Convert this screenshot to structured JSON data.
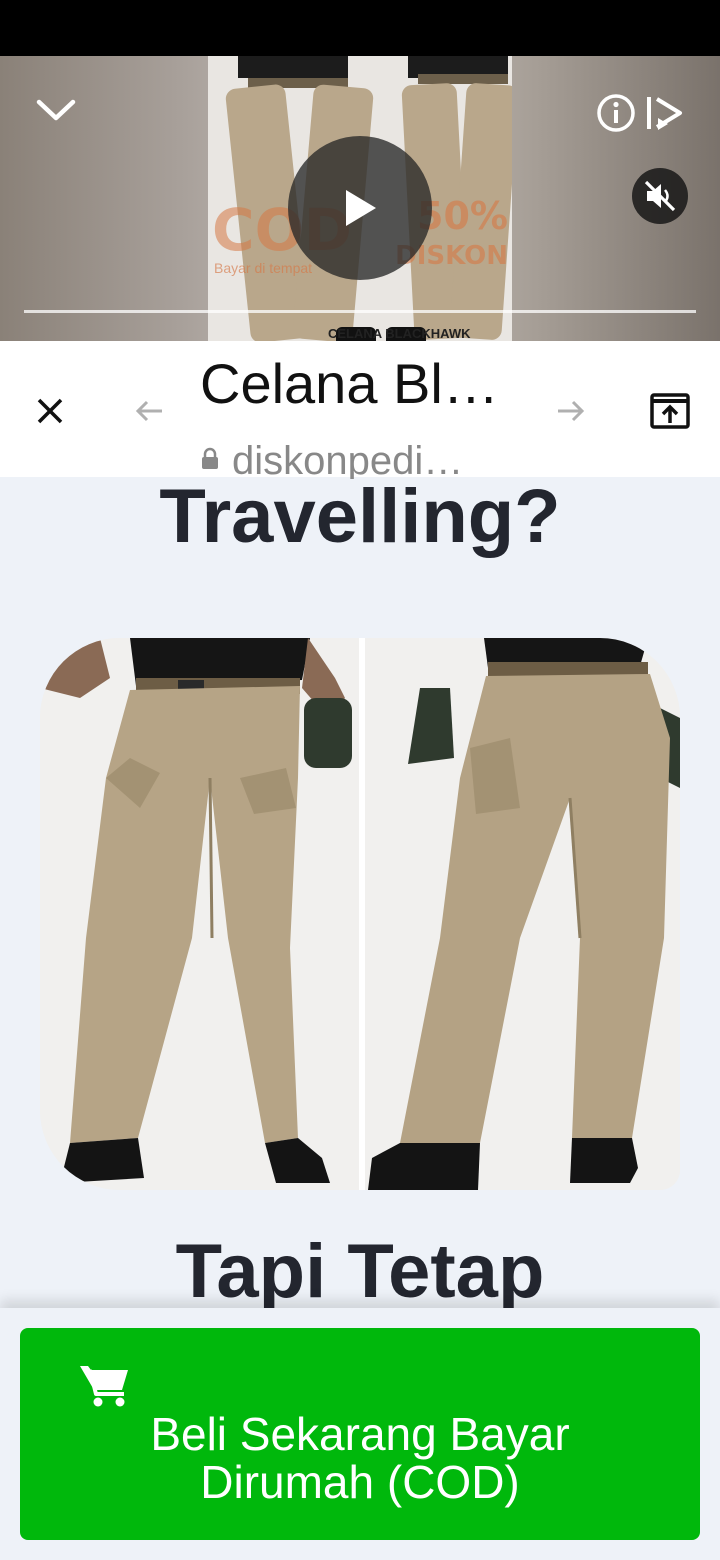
{
  "video": {
    "thumbnail": {
      "cod_text": "COD",
      "cod_sub": "Bayar di tempat",
      "discount_percent": "50%",
      "discount_label": "DISKON",
      "caption": "CELANA BLACKHAWK"
    },
    "icons": {
      "collapse": "chevron-down-icon",
      "play": "play-icon",
      "info": "info-icon",
      "play_next": "play-next-icon",
      "mute": "volume-muted-icon"
    }
  },
  "browser": {
    "title": "Celana Bl…",
    "url": "diskonpedi…",
    "icons": {
      "close": "close-icon",
      "back": "arrow-left-icon",
      "forward": "arrow-right-icon",
      "open_in_browser": "open-in-browser-icon",
      "lock": "lock-icon"
    }
  },
  "page": {
    "heading_1": "Travelling?",
    "heading_2": "Tapi Tetap",
    "product_image": "khaki tactical cargo pants worn by model, front and back views"
  },
  "cta": {
    "label": "Beli Sekarang Bayar Dirumah (COD)",
    "icon": "shopping-cart-icon",
    "color": "#00b80c"
  },
  "colors": {
    "heading": "#23262f",
    "background": "#eef2f8",
    "cta_green": "#00b80c"
  }
}
